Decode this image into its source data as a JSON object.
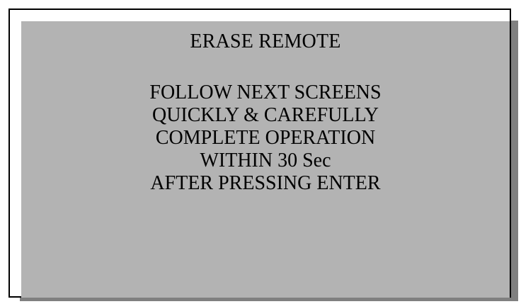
{
  "screen": {
    "title": "ERASE REMOTE",
    "lines": [
      "FOLLOW NEXT SCREENS",
      "QUICKLY & CAREFULLY",
      "COMPLETE OPERATION",
      "WITHIN 30 Sec",
      "AFTER PRESSING ENTER"
    ]
  },
  "colors": {
    "screen_background": "#b3b3b3",
    "shadow": "#808080",
    "border": "#000000"
  }
}
